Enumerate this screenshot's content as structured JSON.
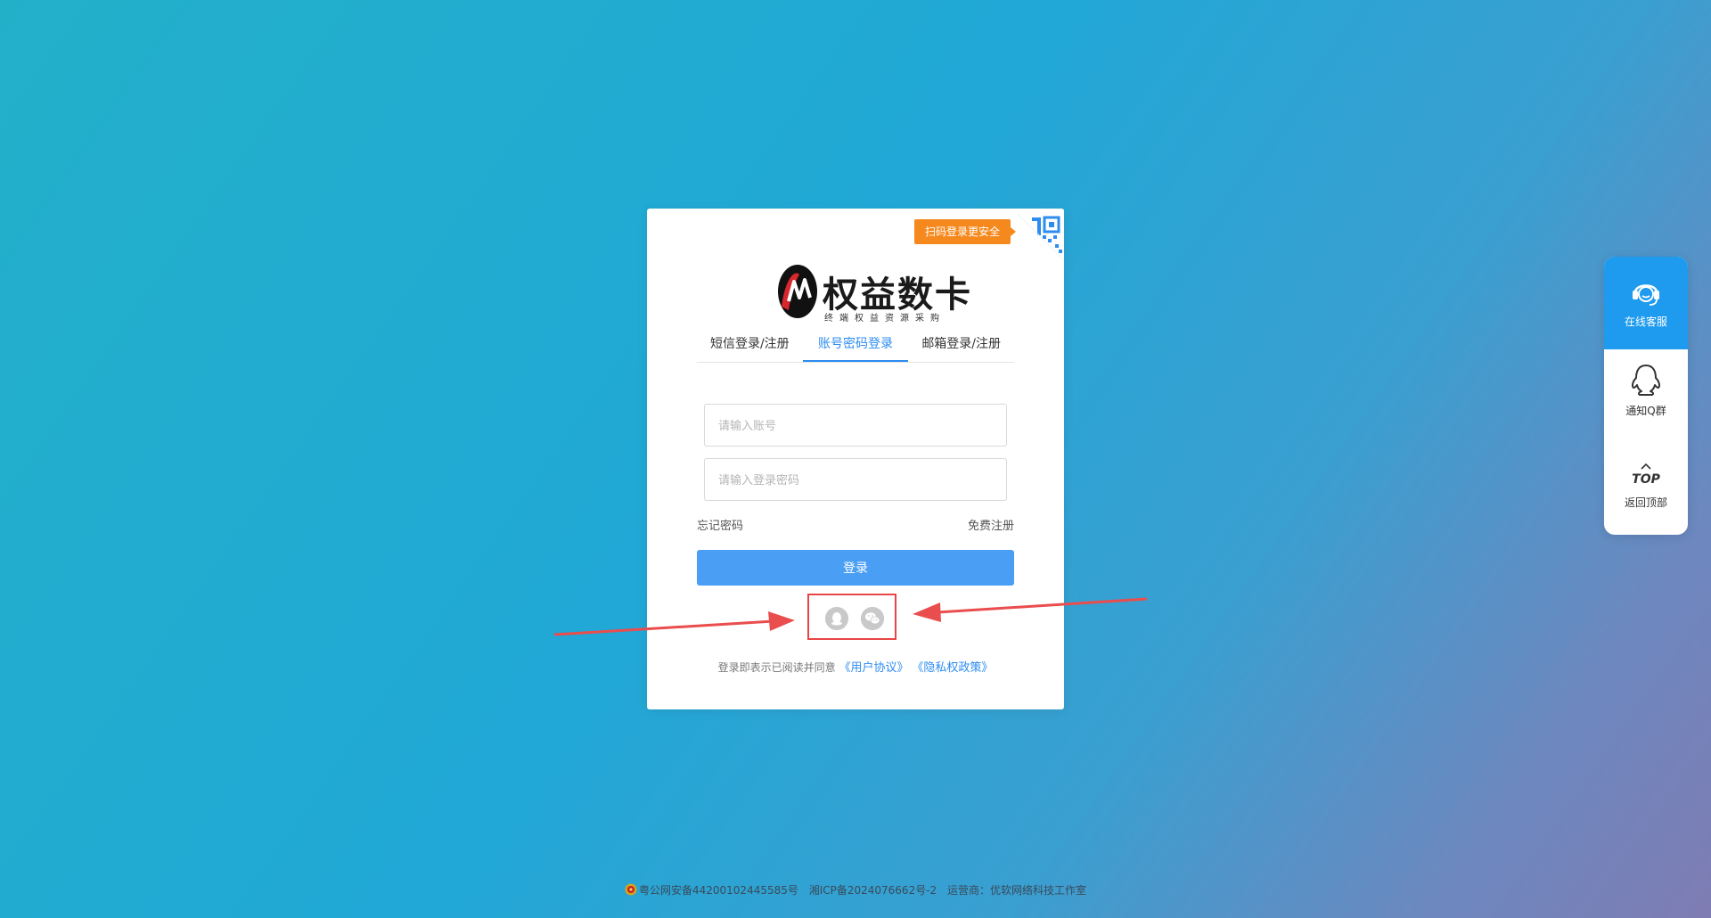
{
  "login_card": {
    "qr_tip": "扫码登录更安全",
    "logo": {
      "title": "权益数卡",
      "subtitle": "终端权益资源采购"
    },
    "tabs": [
      {
        "label": "短信登录/注册",
        "active": false
      },
      {
        "label": "账号密码登录",
        "active": true
      },
      {
        "label": "邮箱登录/注册",
        "active": false
      }
    ],
    "account_input": {
      "placeholder": "请输入账号",
      "value": ""
    },
    "password_input": {
      "placeholder": "请输入登录密码",
      "value": ""
    },
    "forgot_password": "忘记密码",
    "free_register": "免费注册",
    "login_button": "登录",
    "social_icons": [
      "qq-icon",
      "wechat-icon"
    ],
    "agreement": {
      "prefix": "登录即表示已阅读并同意",
      "user_agreement": "《用户协议》",
      "privacy_policy": "《隐私权政策》"
    }
  },
  "float_panel": {
    "service": "在线客服",
    "qgroup": "通知Q群",
    "top_text": "TOP",
    "back_top": "返回顶部"
  },
  "footer": {
    "police": "粤公网安备44200102445585号",
    "icp": "湘ICP备2024076662号-2",
    "operator": "运营商：优软网络科技工作室"
  },
  "colors": {
    "primary": "#2d8cf0",
    "button": "#4a9ff5",
    "qr_tip": "#f5891e",
    "highlight_box": "#e84545"
  }
}
